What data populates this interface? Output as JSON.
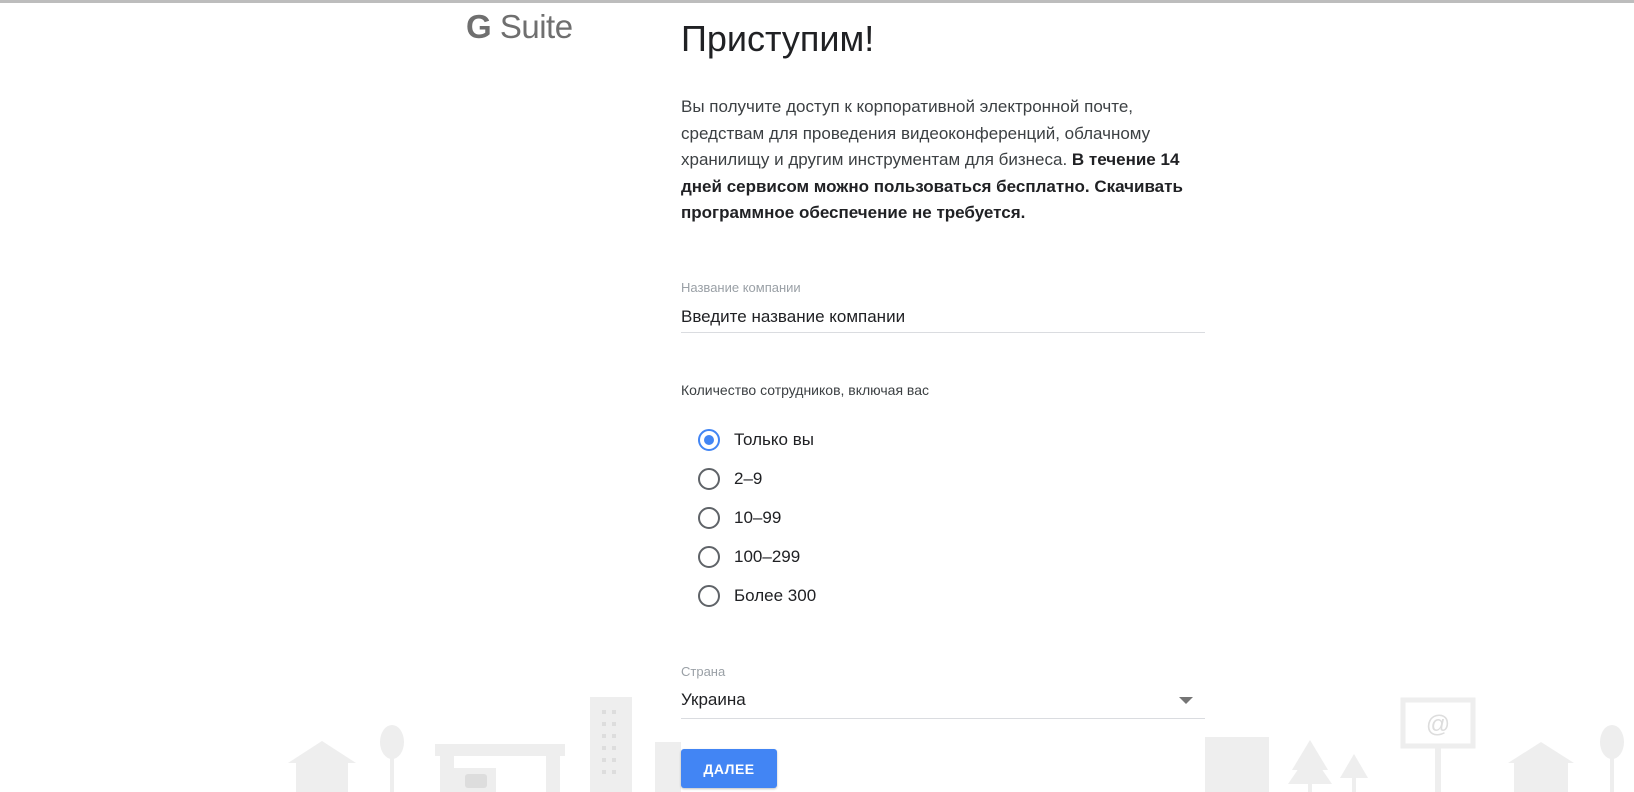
{
  "brand": {
    "logo_g": "G",
    "logo_text": "Suite",
    "logo_color": "#6f6f6f"
  },
  "main": {
    "title": "Приступим!",
    "intro_text": "Вы получите доступ к корпоративной электронной почте, средствам для проведения видеоконференций, облачному хранилищу и другим инструментам для бизнеса. ",
    "intro_bold": "В течение 14 дней сервисом можно пользоваться бесплатно. Скачивать программное обеспечение не требуется."
  },
  "company_field": {
    "label": "Название компании",
    "placeholder": "Введите название компании",
    "value": ""
  },
  "employees": {
    "label": "Количество сотрудников, включая вас",
    "selected_index": 0,
    "options": [
      "Только вы",
      "2–9",
      "10–99",
      "100–299",
      "Более 300"
    ]
  },
  "country_field": {
    "label": "Страна",
    "value": "Украина"
  },
  "next_button": {
    "label": "ДАЛЕЕ"
  },
  "colors": {
    "accent": "#4285f4",
    "scenery": "#eeeeee"
  },
  "icons": {
    "select_caret": "chevron-down-icon",
    "billboard_symbol": "@"
  }
}
